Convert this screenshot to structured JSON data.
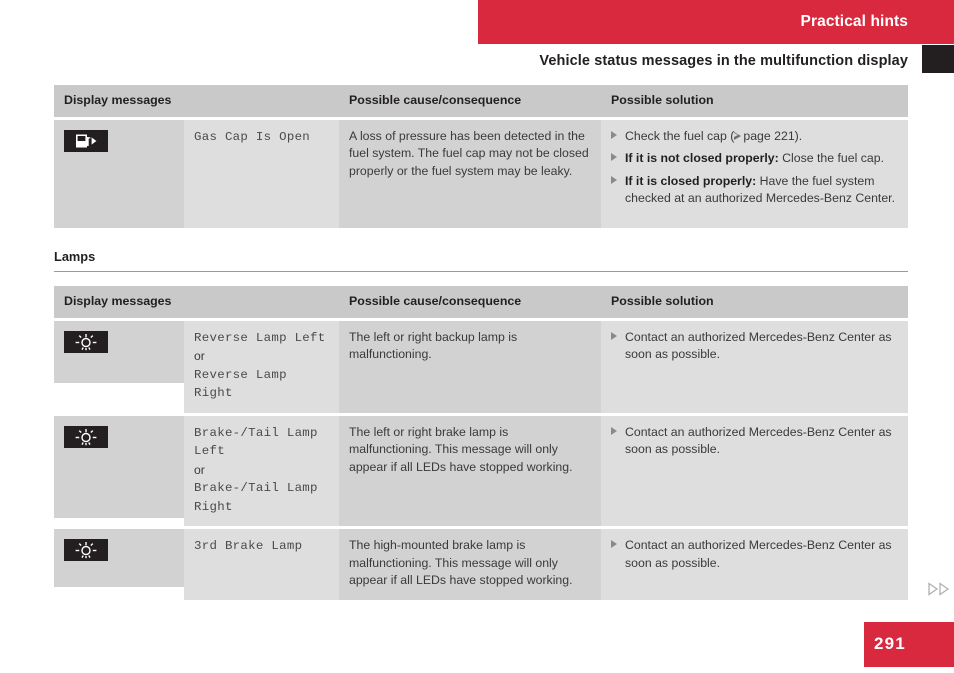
{
  "header": {
    "banner_title": "Practical hints",
    "section_title": "Vehicle status messages in the multifunction display",
    "banner_color": "#d9293e",
    "tab_color": "#231f20"
  },
  "table1": {
    "columns": [
      "Display messages",
      "Possible cause/consequence",
      "Possible solution"
    ],
    "rows": [
      {
        "icon": "fuel-pump-icon",
        "message": "Gas Cap Is Open",
        "cause": "A loss of pressure has been detected in the fuel system. The fuel cap may not be closed properly or the fuel system may be leaky.",
        "solutions": [
          {
            "lead": "",
            "text": "Check the fuel cap (",
            "page_ref": "page 221",
            "tail": ")."
          },
          {
            "lead": "If it is not closed properly:",
            "text": " Close the fuel cap."
          },
          {
            "lead": "If it is closed properly:",
            "text": " Have the fuel system checked at an authorized Mercedes-Benz Center."
          }
        ]
      }
    ]
  },
  "subsection": {
    "title": "Lamps"
  },
  "table2": {
    "columns": [
      "Display messages",
      "Possible cause/consequence",
      "Possible solution"
    ],
    "rows": [
      {
        "icon": "lamp-bulb-icon",
        "message_lines": [
          "Reverse Lamp Left",
          "or",
          "Reverse Lamp Right"
        ],
        "message_plain_indices": [
          1
        ],
        "cause": "The left or right backup lamp is malfunctioning.",
        "solutions": [
          {
            "lead": "",
            "text": "Contact an authorized Mercedes-Benz Center as soon as possible."
          }
        ]
      },
      {
        "icon": "lamp-bulb-icon",
        "message_lines": [
          "Brake-/Tail Lamp",
          "Left",
          "or",
          "Brake-/Tail Lamp",
          "Right"
        ],
        "message_plain_indices": [
          2
        ],
        "cause": "The left or right brake lamp is malfunctioning. This message will only appear if all LEDs have stopped working.",
        "solutions": [
          {
            "lead": "",
            "text": "Contact an authorized Mercedes-Benz Center as soon as possible."
          }
        ]
      },
      {
        "icon": "lamp-bulb-icon",
        "message_lines": [
          "3rd Brake Lamp"
        ],
        "message_plain_indices": [],
        "cause": "The high-mounted brake lamp is malfunctioning. This message will only appear if all LEDs have stopped working.",
        "solutions": [
          {
            "lead": "",
            "text": "Contact an authorized Mercedes-Benz Center as soon as possible."
          }
        ]
      }
    ]
  },
  "footer": {
    "page_number": "291",
    "page_block_color": "#d9293e",
    "next_arrows_icon": "double-chevron-right-icon"
  }
}
